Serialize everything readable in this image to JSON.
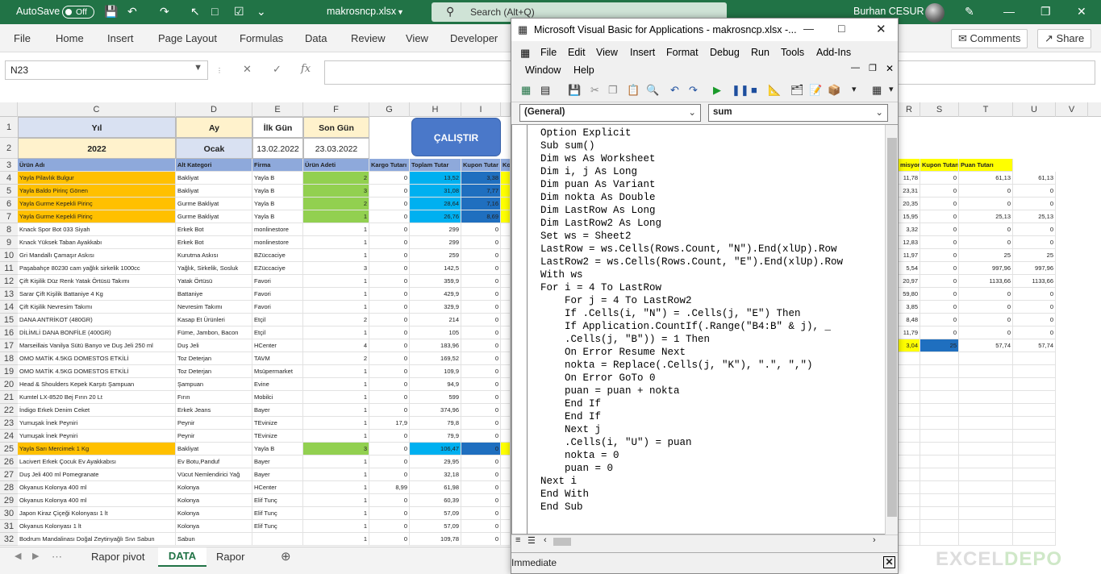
{
  "titlebar": {
    "autosave_label": "AutoSave",
    "autosave_state": "Off",
    "filename": "makrosncp.xlsx",
    "search_placeholder": "Search (Alt+Q)",
    "user": "Burhan CESUR"
  },
  "ribbon": {
    "tabs": [
      "File",
      "Home",
      "Insert",
      "Page Layout",
      "Formulas",
      "Data",
      "Review",
      "View",
      "Developer"
    ],
    "comments": "Comments",
    "share": "Share"
  },
  "formula_bar": {
    "namebox": "N23",
    "fx": "fx"
  },
  "grid": {
    "columns": [
      {
        "letter": "C"
      },
      {
        "letter": "D"
      },
      {
        "letter": "E"
      },
      {
        "letter": "F"
      },
      {
        "letter": "G"
      },
      {
        "letter": "H"
      },
      {
        "letter": "I"
      },
      {
        "letter": ""
      },
      {
        "letter": "R"
      },
      {
        "letter": "S"
      },
      {
        "letter": "T"
      },
      {
        "letter": "U"
      },
      {
        "letter": "V"
      }
    ],
    "header_block": {
      "yil": "Yıl",
      "ay": "Ay",
      "ilk_gun": "İlk Gün",
      "son_gun": "Son Gün",
      "yil_val": "2022",
      "ay_val": "Ocak",
      "ilk_gun_val": "13.02.2022",
      "son_gun_val": "23.03.2022"
    },
    "run_button": "ÇALIŞTIR",
    "row3_headers": [
      "Ürün Adı",
      "Alt Kategori",
      "Firma",
      "Ürün Adeti",
      "Kargo Tutarı",
      "Toplam Tutar",
      "Kupon Tutar",
      "Ko"
    ],
    "row3_right_headers": [
      "misyon",
      "Kupon Tutarı",
      "Puan Tutarı"
    ],
    "rows": [
      {
        "n": "4",
        "c": "Yayla Pilavlık Bulgur",
        "d": "Bakliyat",
        "e": "Yayla B",
        "f": "2",
        "g": "0",
        "h": "13,52",
        "i": "3,38",
        "r": "11,78",
        "s": "0",
        "t": "61,13",
        "u": "61,13"
      },
      {
        "n": "5",
        "c": "Yayla Baldo Pirinç Gönen",
        "d": "Bakliyat",
        "e": "Yayla B",
        "f": "3",
        "g": "0",
        "h": "31,08",
        "i": "7,77",
        "r": "23,31",
        "s": "0",
        "t": "0",
        "u": "0"
      },
      {
        "n": "6",
        "c": "Yayla Gurme Kepekli Pirinç",
        "d": "Gurme Bakliyat",
        "e": "Yayla B",
        "f": "2",
        "g": "0",
        "h": "28,64",
        "i": "7,16",
        "r": "20,35",
        "s": "0",
        "t": "0",
        "u": "0"
      },
      {
        "n": "7",
        "c": "Yayla Gurme Kepekli Pirinç",
        "d": "Gurme Bakliyat",
        "e": "Yayla B",
        "f": "1",
        "g": "0",
        "h": "26,76",
        "i": "8,69",
        "r": "15,95",
        "s": "0",
        "t": "25,13",
        "u": "25,13"
      },
      {
        "n": "8",
        "c": "Knack Spor Bot 033 Siyah",
        "d": "Erkek Bot",
        "e": "monlinestore",
        "f": "1",
        "g": "0",
        "h": "299",
        "i": "0",
        "r": "3,32",
        "s": "0",
        "t": "0",
        "u": "0"
      },
      {
        "n": "9",
        "c": "Knack Yüksek Taban Ayakkabı",
        "d": "Erkek Bot",
        "e": "monlinestore",
        "f": "1",
        "g": "0",
        "h": "299",
        "i": "0",
        "r": "12,83",
        "s": "0",
        "t": "0",
        "u": "0"
      },
      {
        "n": "10",
        "c": "Gri Mandallı Çamaşır Askısı",
        "d": "Kurutma Askısı",
        "e": "BZüccaciye",
        "f": "1",
        "g": "0",
        "h": "259",
        "i": "0",
        "r": "11,97",
        "s": "0",
        "t": "25",
        "u": "25"
      },
      {
        "n": "11",
        "c": "Paşabahçe 80230 cam yağlık sirkelik 1000cc",
        "d": "Yağlık, Sirkelik, Sosluk",
        "e": "EZüccaciye",
        "f": "3",
        "g": "0",
        "h": "142,5",
        "i": "0",
        "r": "5,54",
        "s": "0",
        "t": "997,96",
        "u": "997,96"
      },
      {
        "n": "12",
        "c": "Çift Kişilik Düz Renk Yatak Örtüsü Takımı",
        "d": "Yatak Örtüsü",
        "e": "Favori",
        "f": "1",
        "g": "0",
        "h": "359,9",
        "i": "0",
        "r": "20,97",
        "s": "0",
        "t": "1133,66",
        "u": "1133,66"
      },
      {
        "n": "13",
        "c": "Sarar Çift Kişilik Battaniye 4 Kg",
        "d": "Battaniye",
        "e": "Favori",
        "f": "1",
        "g": "0",
        "h": "429,9",
        "i": "0",
        "r": "59,80",
        "s": "0",
        "t": "0",
        "u": "0"
      },
      {
        "n": "14",
        "c": "Çift Kişilik Nevresim Takımı",
        "d": "Nevresim Takımı",
        "e": "Favori",
        "f": "1",
        "g": "0",
        "h": "329,9",
        "i": "0",
        "r": "3,85",
        "s": "0",
        "t": "0",
        "u": "0"
      },
      {
        "n": "15",
        "c": "DANA ANTRİKOT (480GR)",
        "d": "Kasap Et Ürünleri",
        "e": "Etçil",
        "f": "2",
        "g": "0",
        "h": "214",
        "i": "0",
        "r": "8,48",
        "s": "0",
        "t": "0",
        "u": "0"
      },
      {
        "n": "16",
        "c": "DİLİMLİ DANA BONFİLE (400GR)",
        "d": "Füme, Jambon, Bacon",
        "e": "Etçil",
        "f": "1",
        "g": "0",
        "h": "105",
        "i": "0",
        "r": "11,79",
        "s": "0",
        "t": "0",
        "u": "0"
      },
      {
        "n": "17",
        "c": "Marseillais Vanilya Sütü Banyo ve Duş Jeli 250 ml",
        "d": "Duş Jeli",
        "e": "HCenter",
        "f": "4",
        "g": "0",
        "h": "183,96",
        "i": "0",
        "r": "3,04",
        "s": "25",
        "t": "57,74",
        "u": "57,74"
      },
      {
        "n": "18",
        "c": "OMO MATİK 4.5KG DOMESTOS ETKİLİ",
        "d": "Toz Deterjan",
        "e": "TAVM",
        "f": "2",
        "g": "0",
        "h": "169,52",
        "i": "0",
        "r": "",
        "s": "",
        "t": "",
        "u": ""
      },
      {
        "n": "19",
        "c": "OMO MATİK 4.5KG DOMESTOS ETKİLİ",
        "d": "Toz Deterjan",
        "e": "Msüpermarket",
        "f": "1",
        "g": "0",
        "h": "109,9",
        "i": "0",
        "r": "",
        "s": "",
        "t": "",
        "u": ""
      },
      {
        "n": "20",
        "c": "Head & Shoulders Kepek Karşıtı Şampuan",
        "d": "Şampuan",
        "e": "Evine",
        "f": "1",
        "g": "0",
        "h": "94,9",
        "i": "0",
        "r": "",
        "s": "",
        "t": "",
        "u": ""
      },
      {
        "n": "21",
        "c": "Kumtel LX-8520 Bej Fırın 20 Lt",
        "d": "Fırın",
        "e": "Mobilci",
        "f": "1",
        "g": "0",
        "h": "599",
        "i": "0",
        "r": "",
        "s": "",
        "t": "",
        "u": ""
      },
      {
        "n": "22",
        "c": "İndigo Erkek Denim Ceket",
        "d": "Erkek Jeans",
        "e": "Bayer",
        "f": "1",
        "g": "0",
        "h": "374,96",
        "i": "0",
        "r": "",
        "s": "",
        "t": "",
        "u": ""
      },
      {
        "n": "23",
        "c": "Yumuşak İnek Peyniri",
        "d": "Peynir",
        "e": "TEvinize",
        "f": "1",
        "g": "17,9",
        "h": "79,8",
        "i": "0",
        "r": "",
        "s": "",
        "t": "",
        "u": ""
      },
      {
        "n": "24",
        "c": "Yumuşak İnek Peyniri",
        "d": "Peynir",
        "e": "TEvinize",
        "f": "1",
        "g": "0",
        "h": "79,9",
        "i": "0",
        "r": "",
        "s": "",
        "t": "",
        "u": ""
      },
      {
        "n": "25",
        "c": "Yayla Sarı Mercimek 1 Kg",
        "d": "Bakliyat",
        "e": "Yayla B",
        "f": "3",
        "g": "0",
        "h": "106,47",
        "i": "0",
        "r": "",
        "s": "",
        "t": "",
        "u": ""
      },
      {
        "n": "26",
        "c": "Lacivert Erkek Çocuk Ev Ayakkabısı",
        "d": "Ev Botu,Panduf",
        "e": "Bayer",
        "f": "1",
        "g": "0",
        "h": "29,95",
        "i": "0",
        "r": "",
        "s": "",
        "t": "",
        "u": ""
      },
      {
        "n": "27",
        "c": "Duş Jeli 400 ml Pomegranate",
        "d": "Vücut Nemlendirici Yağ",
        "e": "Bayer",
        "f": "1",
        "g": "0",
        "h": "32,18",
        "i": "0",
        "r": "",
        "s": "",
        "t": "",
        "u": ""
      },
      {
        "n": "28",
        "c": "Okyanus Kolonya 400 ml",
        "d": "Kolonya",
        "e": "HCenter",
        "f": "1",
        "g": "8,99",
        "h": "61,98",
        "i": "0",
        "r": "",
        "s": "",
        "t": "",
        "u": ""
      },
      {
        "n": "29",
        "c": "Okyanus Kolonya 400 ml",
        "d": "Kolonya",
        "e": "Elif Tunç",
        "f": "1",
        "g": "0",
        "h": "60,39",
        "i": "0",
        "r": "",
        "s": "",
        "t": "",
        "u": ""
      },
      {
        "n": "30",
        "c": "Japon Kiraz Çiçeği Kolonyası 1 lt",
        "d": "Kolonya",
        "e": "Elif Tunç",
        "f": "1",
        "g": "0",
        "h": "57,09",
        "i": "0",
        "r": "",
        "s": "",
        "t": "",
        "u": ""
      },
      {
        "n": "31",
        "c": "Okyanus Kolonyası 1 lt",
        "d": "Kolonya",
        "e": "Elif Tunç",
        "f": "1",
        "g": "0",
        "h": "57,09",
        "i": "0",
        "r": "",
        "s": "",
        "t": "",
        "u": ""
      },
      {
        "n": "32",
        "c": "Bodrum Mandalinası Doğal Zeytinyağlı Sıvı Sabun",
        "d": "Sabun",
        "e": "",
        "f": "1",
        "g": "0",
        "h": "109,78",
        "i": "0",
        "r": "",
        "s": "",
        "t": "",
        "u": ""
      }
    ],
    "colors": {
      "orange": "#ffc000",
      "green": "#92d050",
      "blue": "#00b0f0",
      "darkblue": "#1f6fbf",
      "yellow": "#ffff00",
      "header_blue": "#d9e1f2",
      "header_yellow": "#fff2cc",
      "header_dark": "#8ea9db"
    }
  },
  "sheet_tabs": [
    "Rapor pivot",
    "DATA",
    "Rapor"
  ],
  "vba": {
    "title": "Microsoft Visual Basic for Applications - makrosncp.xlsx -...",
    "menu1": [
      "File",
      "Edit",
      "View",
      "Insert",
      "Format",
      "Debug",
      "Run",
      "Tools",
      "Add-Ins"
    ],
    "menu2": [
      "Window",
      "Help"
    ],
    "object_combo": "(General)",
    "proc_combo": "sum",
    "code": [
      "Option Explicit",
      "Sub sum()",
      "Dim ws As Worksheet",
      "Dim i, j As Long",
      "Dim puan As Variant",
      "Dim nokta As Double",
      "Dim LastRow As Long",
      "Dim LastRow2 As Long",
      "Set ws = Sheet2",
      "LastRow = ws.Cells(Rows.Count, \"N\").End(xlUp).Row",
      "LastRow2 = ws.Cells(Rows.Count, \"E\").End(xlUp).Row",
      "With ws",
      "For i = 4 To LastRow",
      "    For j = 4 To LastRow2",
      "    If .Cells(i, \"N\") = .Cells(j, \"E\") Then",
      "    If Application.CountIf(.Range(\"B4:B\" & j), _",
      "    .Cells(j, \"B\")) = 1 Then",
      "    On Error Resume Next",
      "    nokta = Replace(.Cells(j, \"K\"), \".\", \",\")",
      "    On Error GoTo 0",
      "    puan = puan + nokta",
      "    End If",
      "    End If",
      "    Next j",
      "    .Cells(i, \"U\") = puan",
      "    nokta = 0",
      "    puan = 0",
      "Next i",
      "End With",
      "End Sub"
    ],
    "immediate": "Immediate"
  },
  "watermark": {
    "a": "EXCEL",
    "b": "DEPO"
  }
}
